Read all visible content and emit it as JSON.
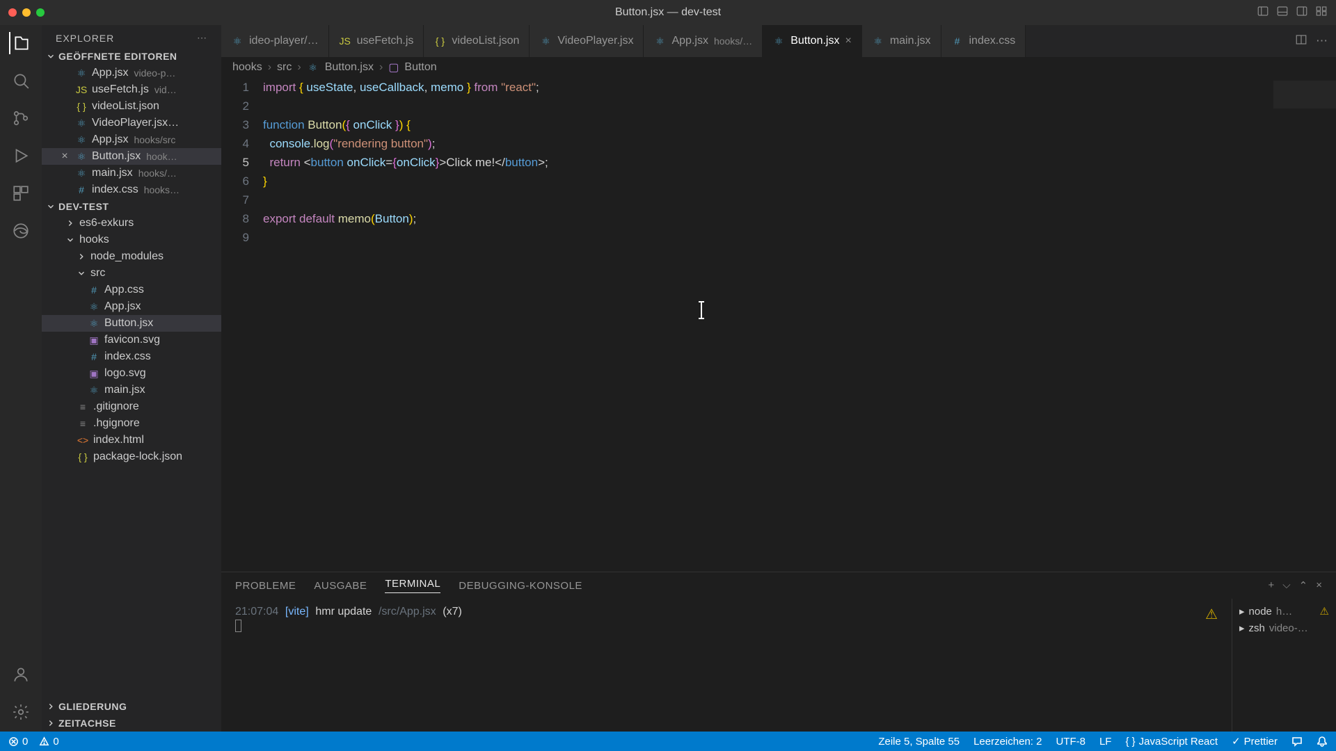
{
  "window": {
    "title": "Button.jsx — dev-test"
  },
  "explorer": {
    "title": "EXPLORER",
    "open_editors_label": "GEÖFFNETE EDITOREN",
    "open_editors": [
      {
        "name": "App.jsx",
        "meta": "video-p…",
        "icon": "react"
      },
      {
        "name": "useFetch.js",
        "meta": "vid…",
        "icon": "js"
      },
      {
        "name": "videoList.json",
        "meta": "",
        "icon": "json"
      },
      {
        "name": "VideoPlayer.jsx…",
        "meta": "",
        "icon": "react"
      },
      {
        "name": "App.jsx",
        "meta": "hooks/src",
        "icon": "react"
      },
      {
        "name": "Button.jsx",
        "meta": "hook…",
        "icon": "react",
        "active": true
      },
      {
        "name": "main.jsx",
        "meta": "hooks/…",
        "icon": "react"
      },
      {
        "name": "index.css",
        "meta": "hooks…",
        "icon": "css"
      }
    ],
    "project_label": "DEV-TEST",
    "tree": [
      {
        "name": "es6-exkurs",
        "type": "folder",
        "depth": 1,
        "expanded": false
      },
      {
        "name": "hooks",
        "type": "folder",
        "depth": 1,
        "expanded": true
      },
      {
        "name": "node_modules",
        "type": "folder",
        "depth": 2,
        "expanded": false
      },
      {
        "name": "src",
        "type": "folder",
        "depth": 2,
        "expanded": true
      },
      {
        "name": "App.css",
        "type": "file",
        "depth": 3,
        "icon": "css"
      },
      {
        "name": "App.jsx",
        "type": "file",
        "depth": 3,
        "icon": "react"
      },
      {
        "name": "Button.jsx",
        "type": "file",
        "depth": 3,
        "icon": "react",
        "active": true
      },
      {
        "name": "favicon.svg",
        "type": "file",
        "depth": 3,
        "icon": "svg"
      },
      {
        "name": "index.css",
        "type": "file",
        "depth": 3,
        "icon": "css"
      },
      {
        "name": "logo.svg",
        "type": "file",
        "depth": 3,
        "icon": "svg"
      },
      {
        "name": "main.jsx",
        "type": "file",
        "depth": 3,
        "icon": "react"
      },
      {
        "name": ".gitignore",
        "type": "file",
        "depth": 2,
        "icon": "txt"
      },
      {
        "name": ".hgignore",
        "type": "file",
        "depth": 2,
        "icon": "txt"
      },
      {
        "name": "index.html",
        "type": "file",
        "depth": 2,
        "icon": "html"
      },
      {
        "name": "package-lock.json",
        "type": "file",
        "depth": 2,
        "icon": "json"
      }
    ],
    "outline_label": "GLIEDERUNG",
    "timeline_label": "ZEITACHSE"
  },
  "tabs": [
    {
      "label": "ideo-player/…",
      "icon": "react"
    },
    {
      "label": "useFetch.js",
      "icon": "js"
    },
    {
      "label": "videoList.json",
      "icon": "json"
    },
    {
      "label": "VideoPlayer.jsx",
      "icon": "react"
    },
    {
      "label": "App.jsx",
      "meta": "hooks/…",
      "icon": "react"
    },
    {
      "label": "Button.jsx",
      "icon": "react",
      "active": true,
      "closeable": true
    },
    {
      "label": "main.jsx",
      "icon": "react"
    },
    {
      "label": "index.css",
      "icon": "css"
    }
  ],
  "breadcrumb": [
    "hooks",
    "src",
    "Button.jsx",
    "Button"
  ],
  "code": {
    "lines": [
      1,
      2,
      3,
      4,
      5,
      6,
      7,
      8,
      9
    ],
    "current": 5
  },
  "panel": {
    "tabs": [
      "PROBLEME",
      "AUSGABE",
      "TERMINAL",
      "DEBUGGING-KONSOLE"
    ],
    "active": 2,
    "terminal": {
      "time": "21:07:04",
      "tag": "[vite]",
      "msg": "hmr update",
      "path": "/src/App.jsx",
      "count": "(x7)"
    },
    "term_list": [
      {
        "name": "node",
        "meta": "h…",
        "warn": true
      },
      {
        "name": "zsh",
        "meta": "video-…"
      }
    ]
  },
  "status": {
    "errors": "0",
    "warnings": "0",
    "line_col": "Zeile 5, Spalte 55",
    "spaces": "Leerzeichen: 2",
    "encoding": "UTF-8",
    "eol": "LF",
    "lang": "JavaScript React",
    "formatter": "Prettier"
  }
}
